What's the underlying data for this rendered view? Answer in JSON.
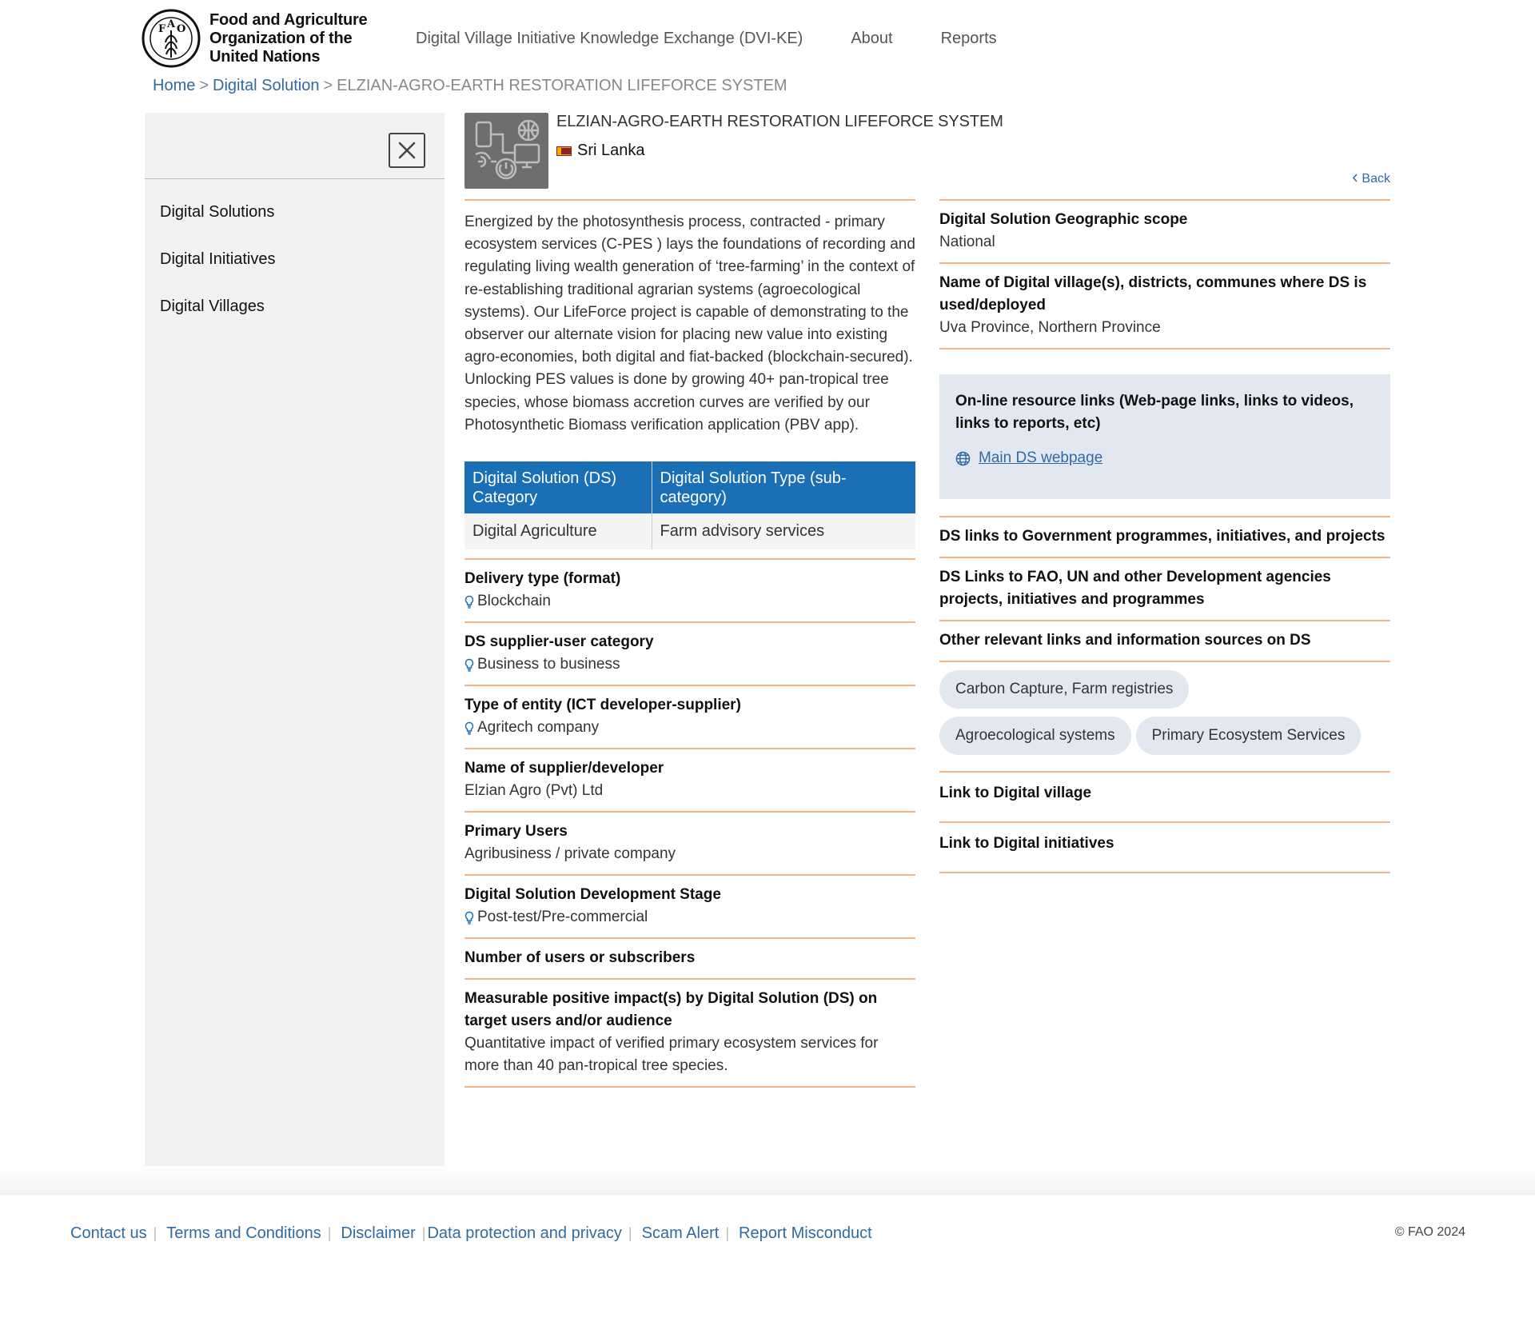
{
  "header": {
    "org_name_line1": "Food and Agriculture",
    "org_name_line2": "Organization of the",
    "org_name_line3": "United Nations",
    "nav": [
      {
        "label": "Digital Village Initiative Knowledge Exchange (DVI-KE)"
      },
      {
        "label": "About"
      },
      {
        "label": "Reports"
      }
    ]
  },
  "breadcrumb": {
    "home": "Home",
    "section": "Digital Solution",
    "current": "ELZIAN-AGRO-EARTH RESTORATION LIFEFORCE SYSTEM"
  },
  "sidebar": {
    "items": [
      {
        "label": "Digital Solutions"
      },
      {
        "label": "Digital Initiatives"
      },
      {
        "label": "Digital Villages"
      }
    ]
  },
  "solution": {
    "title": "ELZIAN-AGRO-EARTH RESTORATION LIFEFORCE SYSTEM",
    "country": "Sri Lanka",
    "back_label": "Back",
    "description": "Energized by the photosynthesis process, contracted - primary ecosystem services (C-PES ) lays the foundations of recording and regulating living wealth generation of ‘tree-farming’ in the context of re-establishing traditional agrarian systems (agroecological systems). Our LifeForce project is capable of demonstrating to the observer our alternate vision for placing new value into existing agro-economies, both digital and fiat-backed (blockchain-secured). Unlocking PES values is done by growing 40+ pan-tropical tree species, whose biomass accretion curves are verified by our Photosynthetic Biomass verification application (PBV app).",
    "category_table": {
      "headers": [
        "Digital Solution (DS) Category",
        "Digital Solution Type (sub-category)"
      ],
      "row": [
        "Digital Agriculture",
        "Farm advisory services"
      ]
    },
    "fields": {
      "delivery_type": {
        "label": "Delivery type (format)",
        "value": "Blockchain"
      },
      "supplier_user_category": {
        "label": "DS supplier-user category",
        "value": "Business to business"
      },
      "entity_type": {
        "label": "Type of entity (ICT developer-supplier)",
        "value": "Agritech company"
      },
      "supplier_name": {
        "label": "Name of supplier/developer",
        "value": "Elzian Agro (Pvt) Ltd"
      },
      "primary_users": {
        "label": "Primary Users",
        "value": "Agribusiness / private company"
      },
      "dev_stage": {
        "label": "Digital Solution Development Stage",
        "value": "Post-test/Pre-commercial"
      },
      "num_users": {
        "label": "Number of users or subscribers"
      },
      "impact": {
        "label": "Measurable positive impact(s) by Digital Solution (DS) on target users and/or audience",
        "value": "Quantitative impact of verified primary ecosystem services for more than 40 pan-tropical tree species."
      }
    },
    "right": {
      "geo_scope": {
        "label": "Digital Solution Geographic scope",
        "value": "National"
      },
      "locations": {
        "label": "Name of Digital village(s), districts, communes where DS is used/deployed",
        "value": "Uva Province, Northern Province"
      },
      "resources": {
        "label": "On-line resource links (Web-page links, links to videos, links to reports, etc)",
        "link": "Main DS webpage"
      },
      "gov_links": {
        "label": "DS links to Government programmes, initiatives, and projects"
      },
      "fao_links": {
        "label": "DS Links to FAO, UN and other Development agencies projects, initiatives and programmes"
      },
      "other_links": {
        "label": "Other relevant links and information sources on DS"
      },
      "tags": [
        "Carbon Capture, Farm registries",
        "Agroecological systems",
        "Primary Ecosystem Services"
      ],
      "village_link": {
        "label": "Link to Digital village"
      },
      "initiative_link": {
        "label": "Link to Digital initiatives"
      }
    }
  },
  "footer": {
    "links": [
      "Contact us",
      "Terms and Conditions",
      "Disclaimer",
      "Data protection and privacy",
      "Scam Alert",
      "Report Misconduct"
    ],
    "copyright": "© FAO 2024"
  },
  "colors": {
    "accent_blue": "#1a6fb5",
    "link_blue": "#2f6aa3",
    "divider_orange": "#f0b58a",
    "sidebar_bg": "#f2f2f2",
    "resource_bg": "#e3e8f0"
  }
}
